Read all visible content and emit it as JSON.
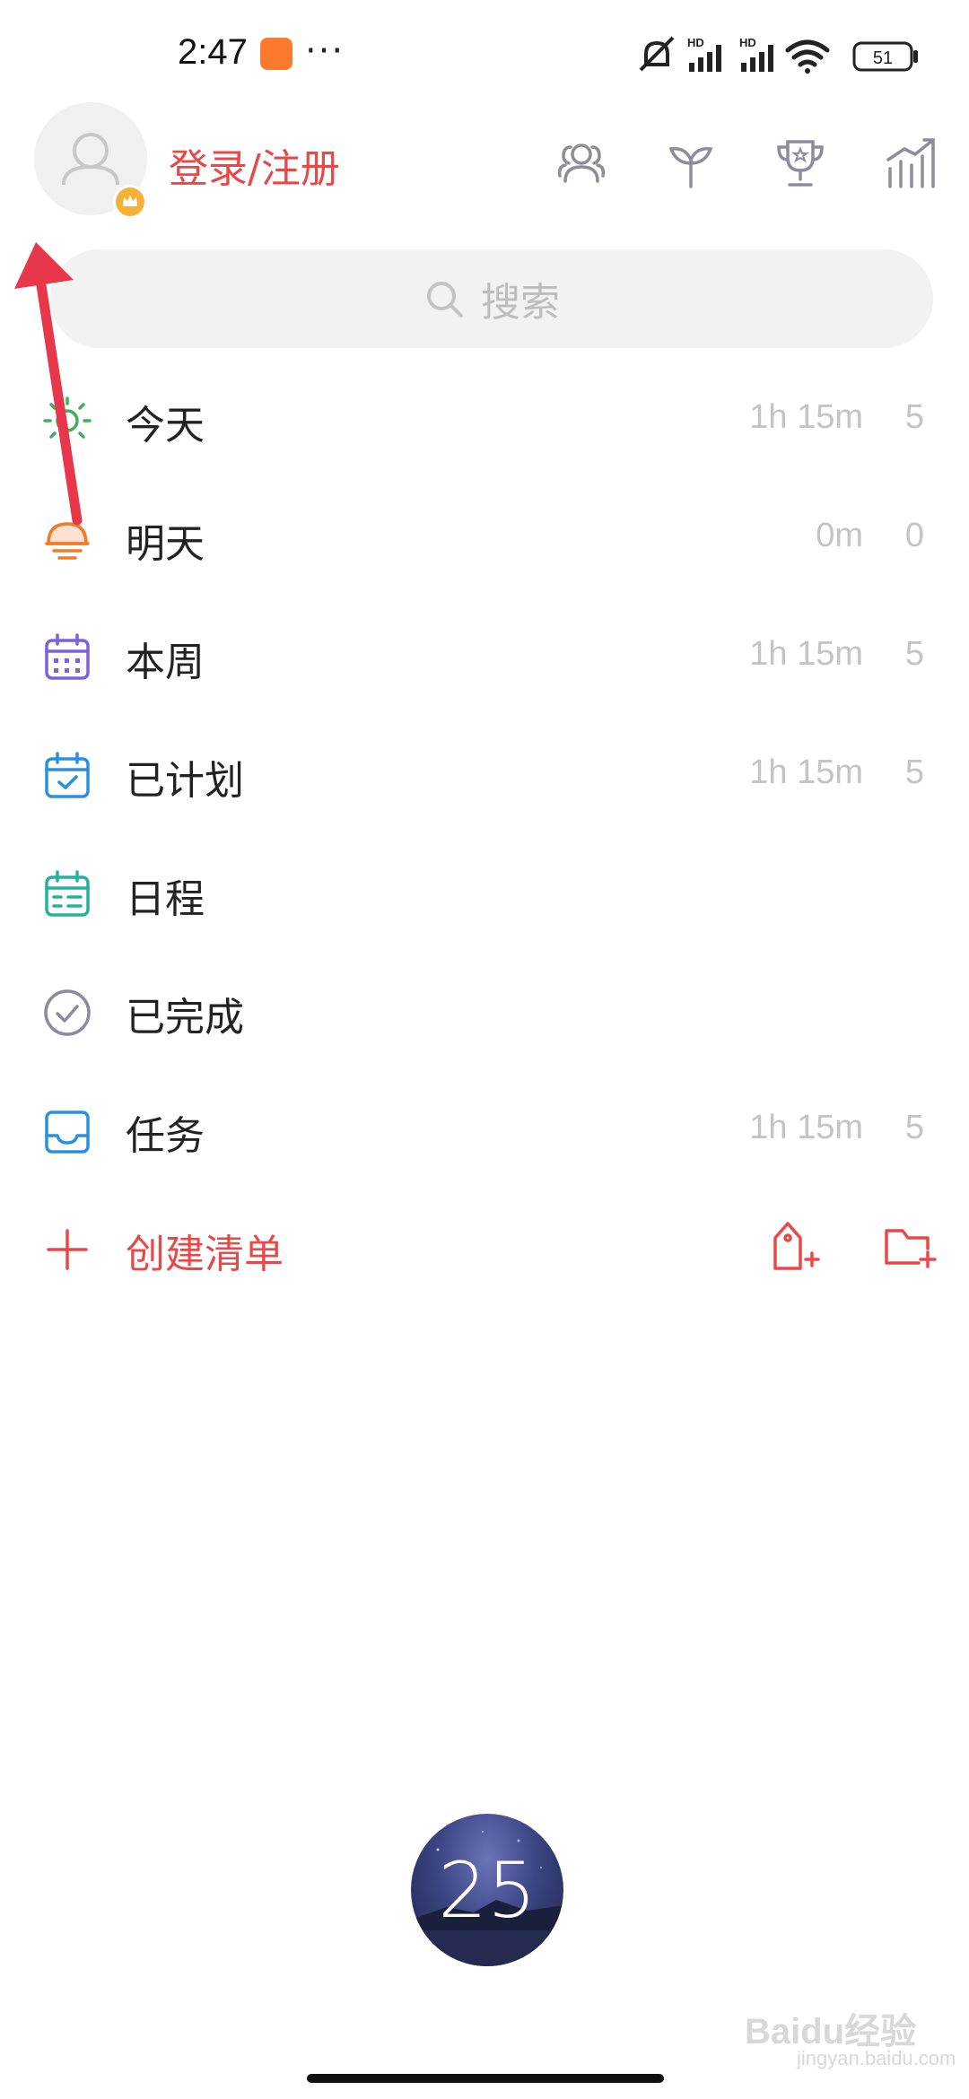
{
  "status_bar": {
    "time": "2:47",
    "dots": "···",
    "battery": "51"
  },
  "header": {
    "login_label": "登录/注册",
    "icons": [
      "friends-icon",
      "sprout-icon",
      "trophy-icon",
      "statistics-icon"
    ]
  },
  "search": {
    "placeholder": "搜索"
  },
  "lists": [
    {
      "label": "今天",
      "time": "1h 15m",
      "count": "5",
      "icon": "sun-icon",
      "color": "#3fae5f"
    },
    {
      "label": "明天",
      "time": "0m",
      "count": "0",
      "icon": "sunrise-icon",
      "color": "#f07a2c"
    },
    {
      "label": "本周",
      "time": "1h 15m",
      "count": "5",
      "icon": "calendar-week-icon",
      "color": "#7b62d8"
    },
    {
      "label": "已计划",
      "time": "1h 15m",
      "count": "5",
      "icon": "calendar-check-icon",
      "color": "#2b8fe0"
    },
    {
      "label": "日程",
      "time": "",
      "count": "",
      "icon": "schedule-icon",
      "color": "#23b39a"
    },
    {
      "label": "已完成",
      "time": "",
      "count": "",
      "icon": "completed-icon",
      "color": "#8a8aa0"
    },
    {
      "label": "任务",
      "time": "1h 15m",
      "count": "5",
      "icon": "inbox-icon",
      "color": "#2b8fe0"
    }
  ],
  "create": {
    "label": "创建清单"
  },
  "pomodoro": {
    "value": "25"
  },
  "watermark": {
    "text": "Baidu经验",
    "sub": "jingyan.baidu.com"
  },
  "colors": {
    "accent": "#e94848",
    "annotation_arrow": "#e8374a"
  }
}
